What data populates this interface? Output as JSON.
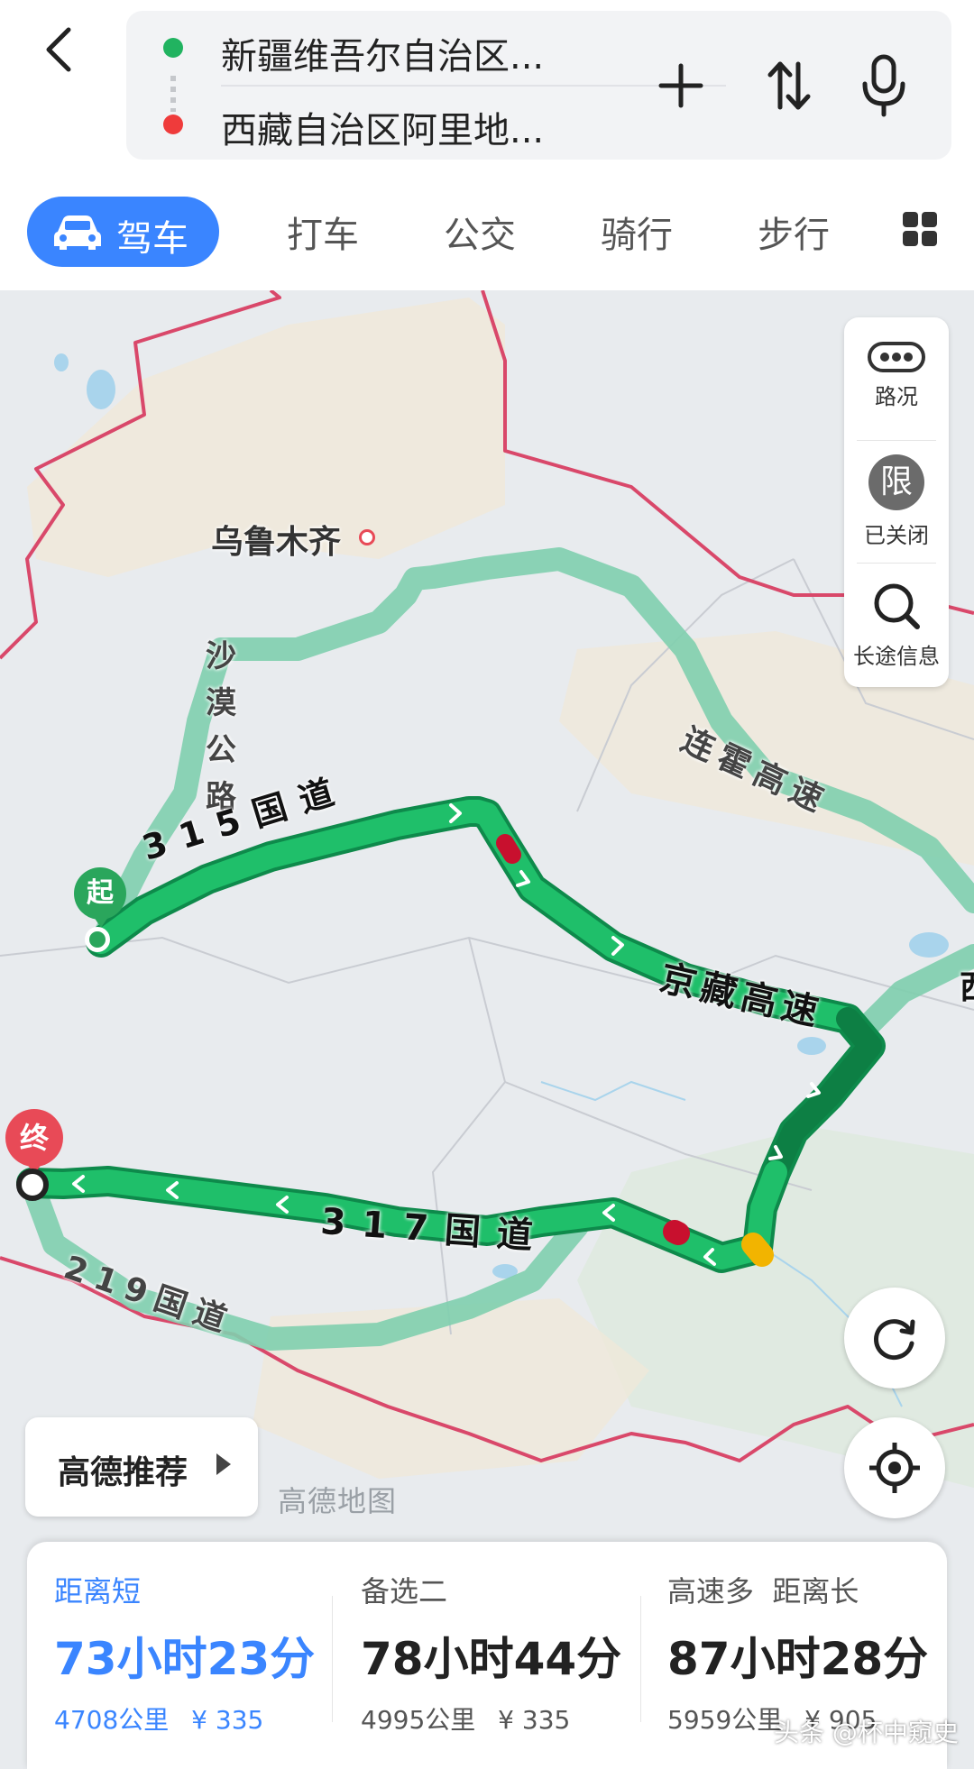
{
  "header": {
    "origin": "新疆维吾尔自治区...",
    "destination": "西藏自治区阿里地..."
  },
  "tabs": [
    {
      "label": "驾车",
      "active": true
    },
    {
      "label": "打车"
    },
    {
      "label": "公交"
    },
    {
      "label": "骑行"
    },
    {
      "label": "步行"
    }
  ],
  "map": {
    "city_label": "乌鲁木齐",
    "road_labels": {
      "desert_road": "沙漠公路",
      "g315": "315国道",
      "lianhuo": "连霍高速",
      "jingzang": "京藏高速",
      "g317": "317国道",
      "g219": "219国道",
      "edge_char": "西"
    },
    "start_marker": "起",
    "end_marker": "终",
    "watermark": "高德地图",
    "colors": {
      "route_main": "#1fb868",
      "route_dark": "#0f8f4e",
      "route_alt": "#8fd6b6",
      "border": "#d9486a",
      "start": "#2aa65c",
      "end": "#e84a57"
    }
  },
  "controls": {
    "traffic": "路况",
    "restrict_icon": "限",
    "restrict": "已关闭",
    "longtrip": "长途信息"
  },
  "recommend": "高德推荐",
  "routes": [
    {
      "tag": "距离短",
      "time": "73小时23分",
      "distance": "4708公里",
      "toll": "¥ 335",
      "selected": true
    },
    {
      "tag": "备选二",
      "time": "78小时44分",
      "distance": "4995公里",
      "toll": "¥ 335"
    },
    {
      "tag": "高速多  距离长",
      "time": "87小时28分",
      "distance": "5959公里",
      "toll": "¥ 905"
    }
  ],
  "footer_watermark": "头条 @杯中窥史"
}
